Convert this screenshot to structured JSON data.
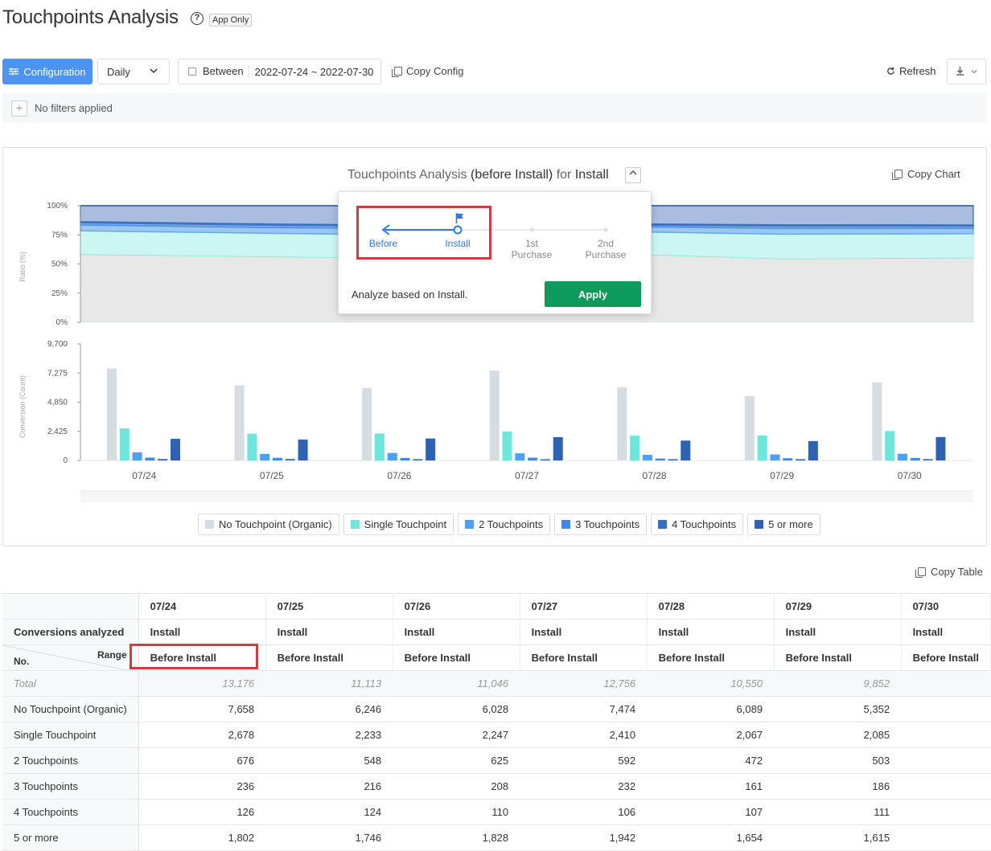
{
  "header": {
    "title": "Touchpoints Analysis",
    "help_glyph": "?",
    "badge": "App Only"
  },
  "toolbar": {
    "config_label": "Configuration",
    "interval_value": "Daily",
    "date_label": "Between",
    "date_value": "2022-07-24 ~ 2022-07-30",
    "copy_config_label": "Copy Config",
    "refresh_label": "Refresh"
  },
  "filters": {
    "add_glyph": "+",
    "text": "No filters applied"
  },
  "chart": {
    "title_prefix": "Touchpoints Analysis",
    "title_range": "(before Install)",
    "title_for": "for",
    "title_event": "Install",
    "copy_label": "Copy Chart",
    "ratio_axis_label": "Ratio (%)",
    "count_axis_label": "Conversion (Count)",
    "ratio_ticks": [
      "100%",
      "75%",
      "50%",
      "25%",
      "0%"
    ],
    "count_ticks": [
      "9,700",
      "7,275",
      "4,850",
      "2,425",
      "0"
    ]
  },
  "legend": [
    {
      "label": "No Touchpoint (Organic)",
      "color": "#d5dde2"
    },
    {
      "label": "Single Touchpoint",
      "color": "#6ee6db"
    },
    {
      "label": "2 Touchpoints",
      "color": "#4f9ff2"
    },
    {
      "label": "3 Touchpoints",
      "color": "#4286e6"
    },
    {
      "label": "4 Touchpoints",
      "color": "#3570c6"
    },
    {
      "label": "5 or more",
      "color": "#2f62b3"
    }
  ],
  "popover": {
    "steps": [
      "Before",
      "Install",
      "1st Purchase",
      "2nd Purchase"
    ],
    "message": "Analyze based on Install.",
    "apply_label": "Apply"
  },
  "chart_data": {
    "type": "bar",
    "categories": [
      "07/24",
      "07/25",
      "07/26",
      "07/27",
      "07/28",
      "07/29",
      "07/30"
    ],
    "ylim": [
      0,
      9700
    ],
    "series": [
      {
        "name": "No Touchpoint (Organic)",
        "values": [
          7658,
          6246,
          6028,
          7474,
          6089,
          5352,
          6500
        ]
      },
      {
        "name": "Single Touchpoint",
        "values": [
          2678,
          2233,
          2247,
          2410,
          2067,
          2085,
          2450
        ]
      },
      {
        "name": "2 Touchpoints",
        "values": [
          676,
          548,
          625,
          592,
          472,
          503,
          560
        ]
      },
      {
        "name": "3 Touchpoints",
        "values": [
          236,
          216,
          208,
          232,
          161,
          186,
          210
        ]
      },
      {
        "name": "4 Touchpoints",
        "values": [
          126,
          124,
          110,
          106,
          107,
          111,
          115
        ]
      },
      {
        "name": "5 or more",
        "values": [
          1802,
          1746,
          1828,
          1942,
          1654,
          1615,
          1950
        ]
      }
    ],
    "ratio_chart": {
      "type": "area",
      "ylim": [
        0,
        100
      ],
      "stack_order": [
        "No Touchpoint (Organic)",
        "Single Touchpoint",
        "2 Touchpoints",
        "3 Touchpoints",
        "4 Touchpoints",
        "5 or more"
      ]
    }
  },
  "table": {
    "copy_label": "Copy Table",
    "dates": [
      "07/24",
      "07/25",
      "07/26",
      "07/27",
      "07/28",
      "07/29",
      "07/30"
    ],
    "conversions_label": "Conversions analyzed",
    "conversions_value": "Install",
    "range_label": "Range",
    "no_label": "No.",
    "range_value": "Before Install",
    "total_label": "Total",
    "totals": [
      "13,176",
      "11,113",
      "11,046",
      "12,756",
      "10,550",
      "9,852",
      ""
    ],
    "rows": [
      {
        "label": "No Touchpoint (Organic)",
        "values": [
          "7,658",
          "6,246",
          "6,028",
          "7,474",
          "6,089",
          "5,352",
          ""
        ]
      },
      {
        "label": "Single Touchpoint",
        "values": [
          "2,678",
          "2,233",
          "2,247",
          "2,410",
          "2,067",
          "2,085",
          ""
        ]
      },
      {
        "label": "2 Touchpoints",
        "values": [
          "676",
          "548",
          "625",
          "592",
          "472",
          "503",
          ""
        ]
      },
      {
        "label": "3 Touchpoints",
        "values": [
          "236",
          "216",
          "208",
          "232",
          "161",
          "186",
          ""
        ]
      },
      {
        "label": "4 Touchpoints",
        "values": [
          "126",
          "124",
          "110",
          "106",
          "107",
          "111",
          ""
        ]
      },
      {
        "label": "5 or more",
        "values": [
          "1,802",
          "1,746",
          "1,828",
          "1,942",
          "1,654",
          "1,615",
          ""
        ]
      }
    ]
  }
}
